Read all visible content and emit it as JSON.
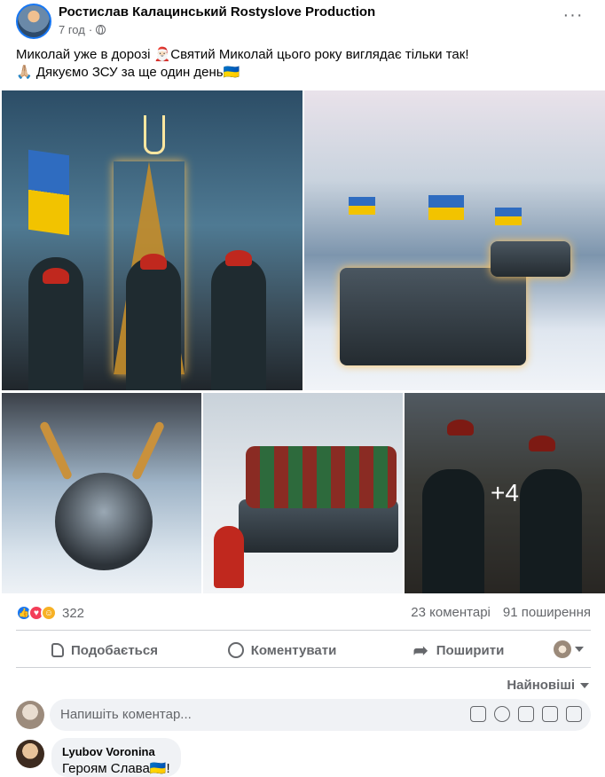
{
  "post": {
    "author": "Ростислав Калацинський Rostyslove Production",
    "time": "7 год",
    "text_line1": "Миколай уже в дорозі 🎅🏻Святий Миколай цього року виглядає тільки так!",
    "text_line2": "🙏🏼 Дякуємо ЗСУ за ще один день🇺🇦",
    "more_label": "···",
    "extra_photos": "+4"
  },
  "reactions": {
    "count": "322",
    "icons": [
      "like-icon",
      "love-icon",
      "care-icon"
    ],
    "comments": "23 коментарі",
    "shares": "91 поширення"
  },
  "actions": {
    "like": "Подобається",
    "comment": "Коментувати",
    "share": "Поширити"
  },
  "comments_section": {
    "sort": "Найновіші",
    "input_placeholder": "Напишіть коментар...",
    "comment": {
      "name": "Lyubov Voronina",
      "text": "Героям Слава🇺🇦!"
    }
  },
  "colors": {
    "accent": "#1877f2",
    "secondary_text": "#65676b",
    "input_bg": "#f0f2f5"
  }
}
